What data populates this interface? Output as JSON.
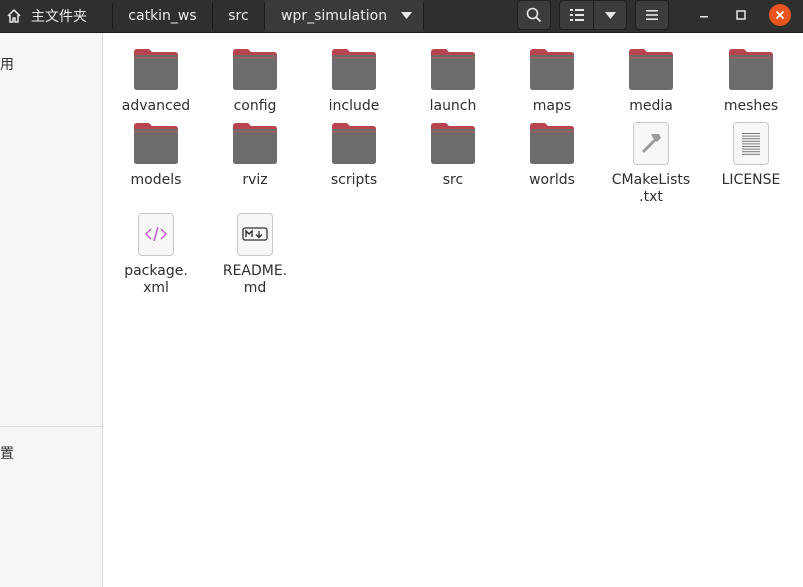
{
  "header": {
    "home_label": "主文件夹",
    "breadcrumbs": [
      "catkin_ws",
      "src",
      "wpr_simulation"
    ]
  },
  "sidebar": {
    "items": [
      {
        "label": "用"
      },
      {
        "label": "置"
      }
    ]
  },
  "files": [
    {
      "name": "advanced",
      "type": "folder"
    },
    {
      "name": "config",
      "type": "folder"
    },
    {
      "name": "include",
      "type": "folder"
    },
    {
      "name": "launch",
      "type": "folder"
    },
    {
      "name": "maps",
      "type": "folder"
    },
    {
      "name": "media",
      "type": "folder"
    },
    {
      "name": "meshes",
      "type": "folder"
    },
    {
      "name": "models",
      "type": "folder"
    },
    {
      "name": "rviz",
      "type": "folder"
    },
    {
      "name": "scripts",
      "type": "folder"
    },
    {
      "name": "src",
      "type": "folder"
    },
    {
      "name": "worlds",
      "type": "folder"
    },
    {
      "name": "CMakeLists\n.txt",
      "type": "cmake"
    },
    {
      "name": "LICENSE",
      "type": "text"
    },
    {
      "name": "package.\nxml",
      "type": "xml"
    },
    {
      "name": "README.\nmd",
      "type": "markdown"
    }
  ],
  "colors": {
    "folder_top": "#b7444f",
    "folder_body": "#6c6c6c",
    "close_button": "#e9541f"
  }
}
